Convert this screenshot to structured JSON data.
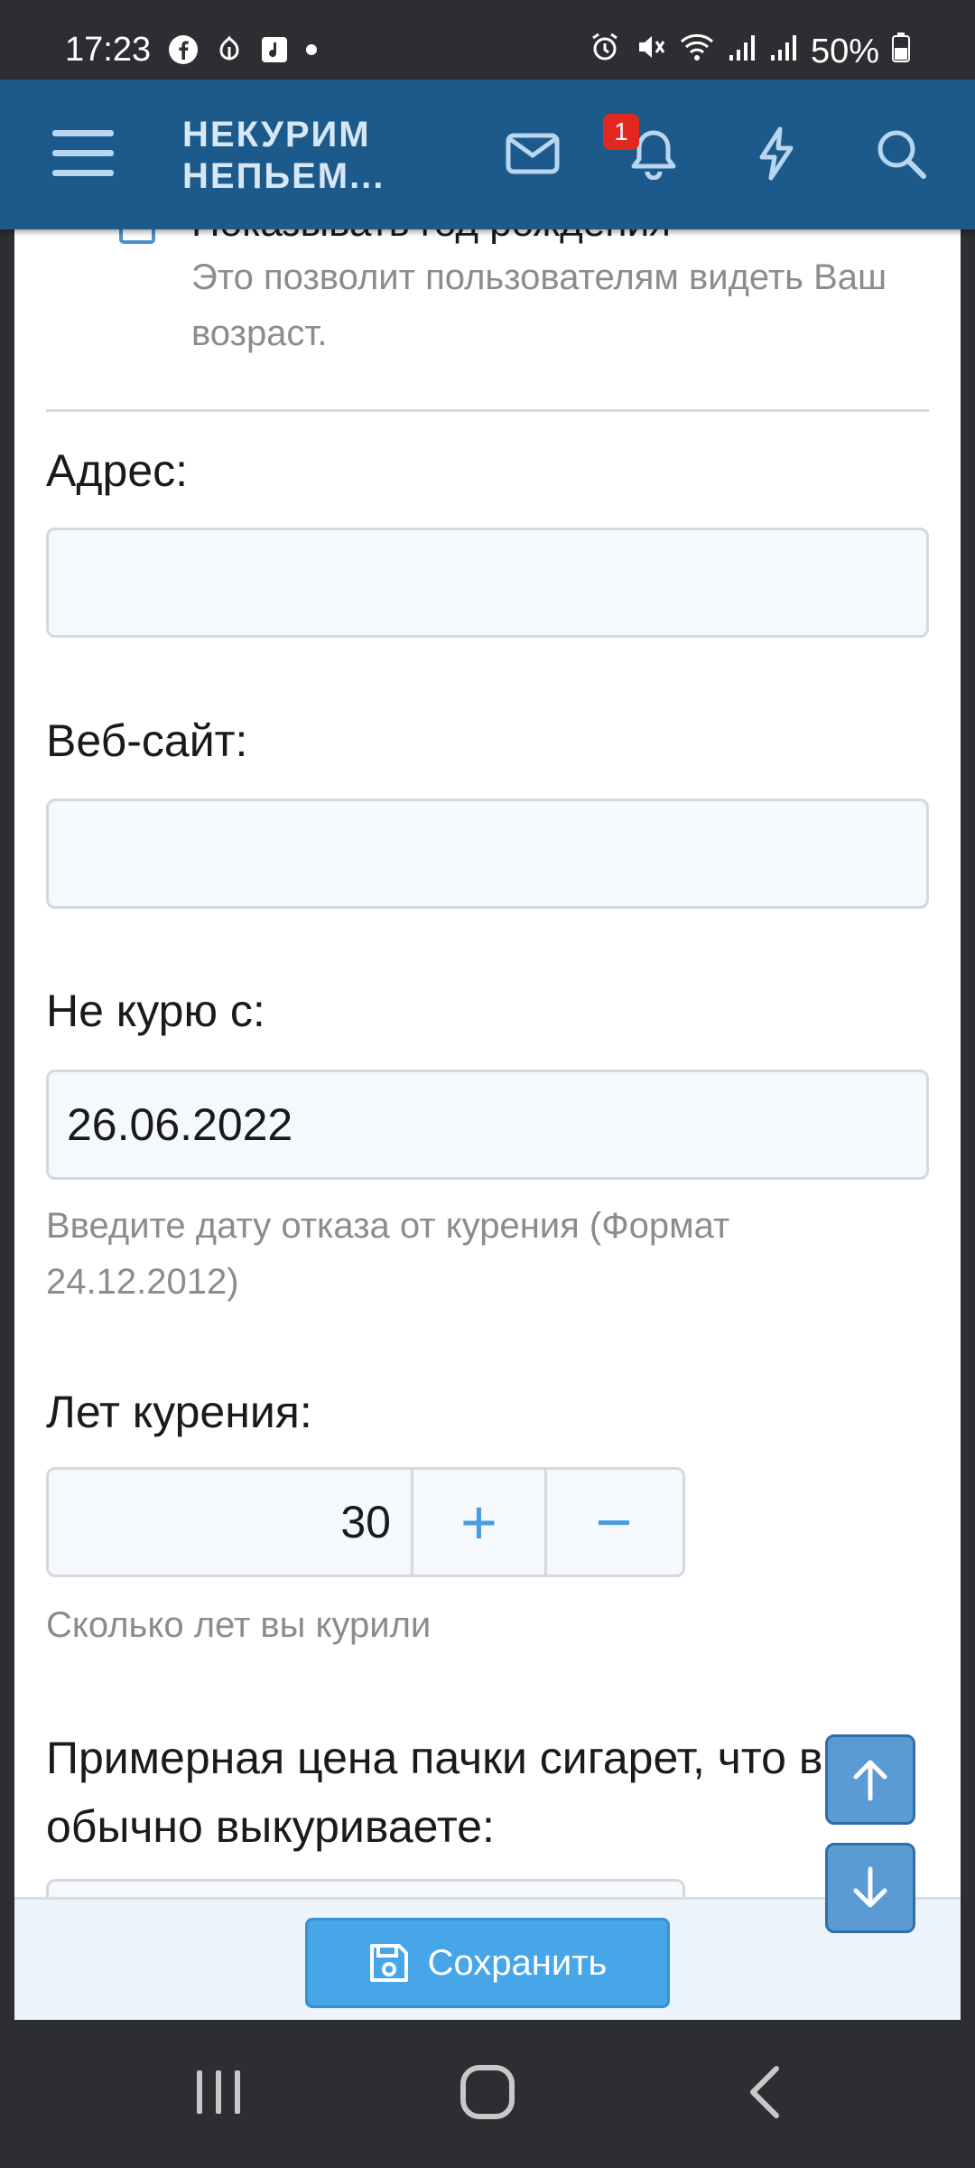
{
  "status_bar": {
    "time": "17:23",
    "battery": "50%",
    "icons_left": [
      "facebook-icon",
      "app-icon",
      "music-icon",
      "dot-icon"
    ],
    "icons_right": [
      "alarm-icon",
      "mute-icon",
      "wifi-icon",
      "signal-icon",
      "signal-icon",
      "battery-icon"
    ]
  },
  "header": {
    "logo_line1": "НЕКУРИМ",
    "logo_line2": "НЕПЬЕМ...",
    "notification_count": "1",
    "colors": {
      "bar": "#1d5a8c",
      "badge": "#e0281f"
    }
  },
  "form": {
    "birth_year_checkbox_label": "Показывать год рождения",
    "birth_year_hint": "Это позволит пользователям видеть Ваш возраст.",
    "address_label": "Адрес:",
    "address_value": "",
    "website_label": "Веб-сайт:",
    "website_value": "",
    "quit_date_label": "Не курю с:",
    "quit_date_value": "26.06.2022",
    "quit_date_hint": "Введите дату отказа от курения (Формат 24.12.2012)",
    "years_label": "Лет курения:",
    "years_value": "30",
    "years_plus": "+",
    "years_minus": "−",
    "years_hint": "Сколько лет вы курили",
    "price_label": "Примерная цена пачки сигарет, что вы обычно выкуриваете:"
  },
  "save_bar": {
    "save_label": "Сохранить",
    "accent": "#47a6e8"
  }
}
